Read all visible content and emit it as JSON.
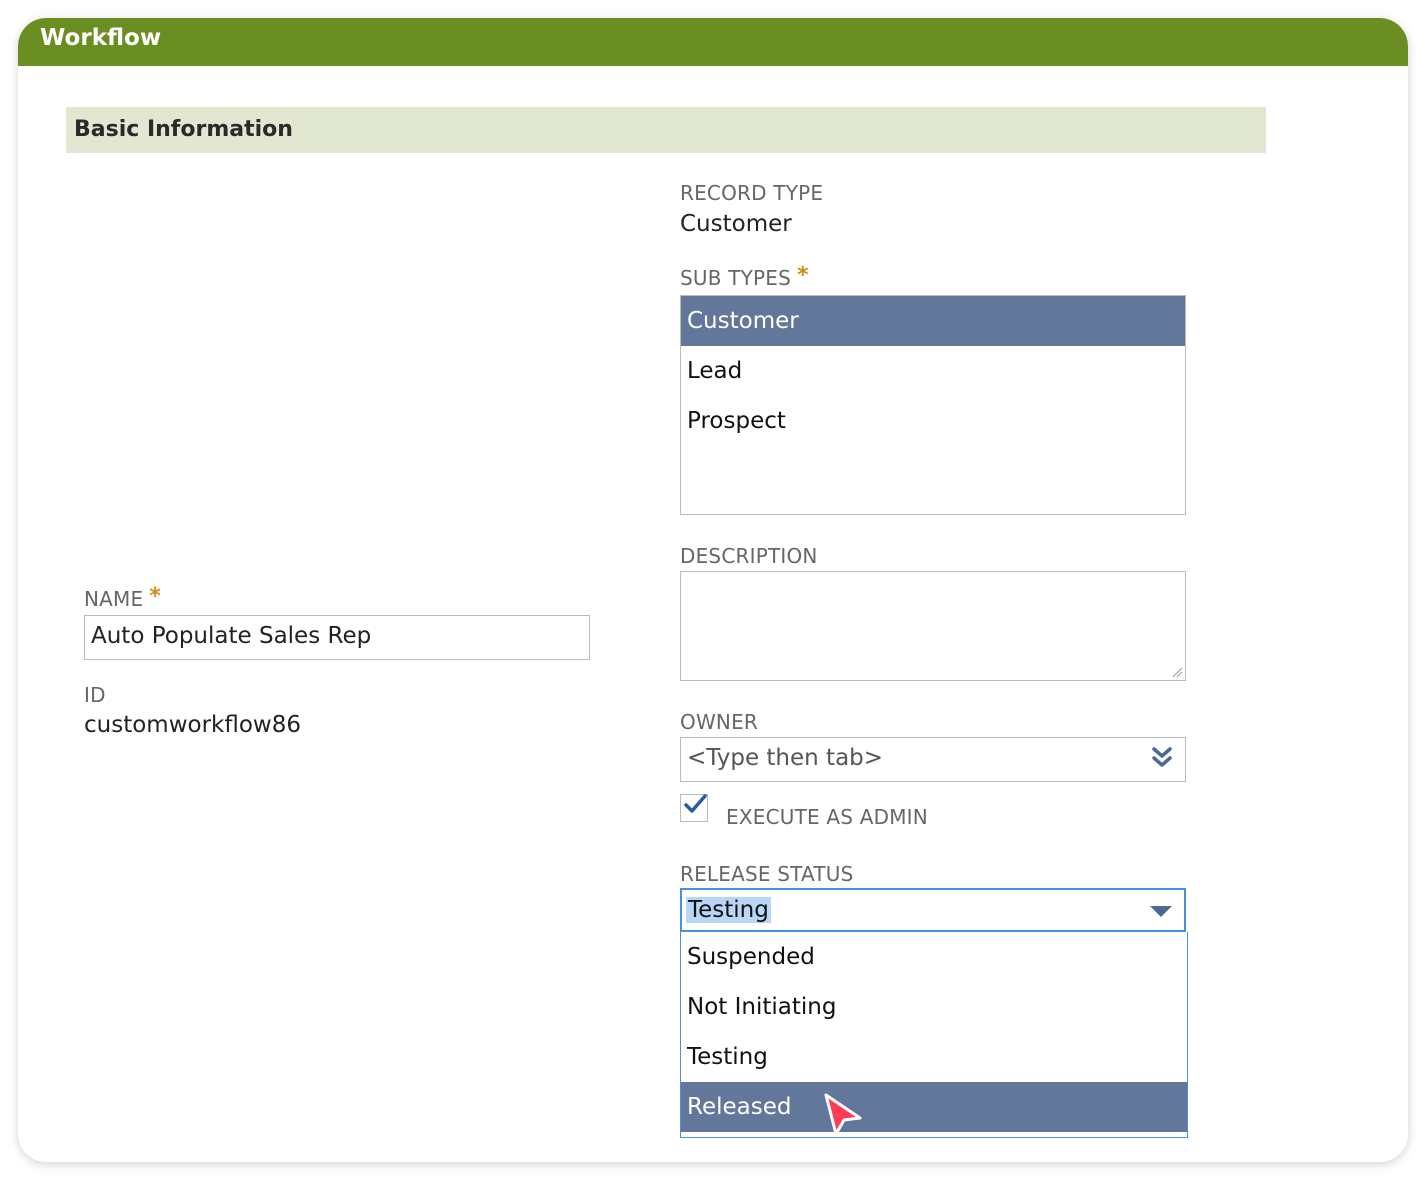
{
  "window": {
    "title": "Workflow"
  },
  "section": {
    "title": "Basic Information"
  },
  "record_type": {
    "label": "RECORD TYPE",
    "value": "Customer"
  },
  "sub_types": {
    "label": "SUB TYPES",
    "required_mark": "*",
    "options": [
      {
        "label": "Customer",
        "selected": true
      },
      {
        "label": "Lead",
        "selected": false
      },
      {
        "label": "Prospect",
        "selected": false
      }
    ]
  },
  "description": {
    "label": "DESCRIPTION",
    "value": ""
  },
  "name": {
    "label": "NAME",
    "required_mark": "*",
    "value": "Auto Populate Sales Rep"
  },
  "id_field": {
    "label": "ID",
    "value": "customworkflow86"
  },
  "owner": {
    "label": "OWNER",
    "placeholder": "<Type then tab>",
    "icon": "double-chevron-down-icon"
  },
  "execute_as_admin": {
    "label": "EXECUTE AS ADMIN",
    "checked": true
  },
  "release_status": {
    "label": "RELEASE STATUS",
    "value": "Testing",
    "options": [
      {
        "label": "Suspended",
        "highlighted": false
      },
      {
        "label": "Not Initiating",
        "highlighted": false
      },
      {
        "label": "Testing",
        "highlighted": false
      },
      {
        "label": "Released",
        "highlighted": true
      }
    ]
  },
  "colors": {
    "title_bar": "#6b8e23",
    "section_header": "#e2e7d2",
    "selection": "#62779a",
    "focus_border": "#4a90e2",
    "required_star": "#d28a14"
  }
}
